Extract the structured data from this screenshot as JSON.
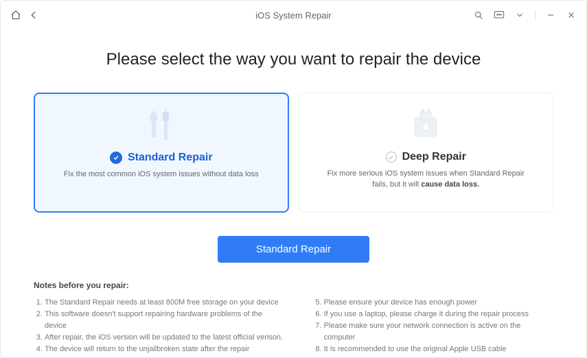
{
  "titlebar": {
    "title": "iOS System Repair"
  },
  "heading": "Please select the way you want to repair the device",
  "cards": {
    "standard": {
      "title": "Standard Repair",
      "desc": "Fix the most common iOS system issues without data loss"
    },
    "deep": {
      "title": "Deep Repair",
      "desc_pre": "Fix more serious iOS system issues when Standard Repair fails, but it will ",
      "desc_em": "cause data loss."
    }
  },
  "action": {
    "primary_label": "Standard Repair"
  },
  "notes": {
    "title": "Notes before you repair:",
    "left": [
      "The Standard Repair needs at least 800M free storage on your device",
      "This software doesn't support repairing hardware problems of the device",
      "After repair, the iOS version will be updated to the latest official verison.",
      "The device will return to the unjailbroken state after the repair"
    ],
    "right": [
      "Please ensure your device has enough power",
      "If you use a laptop, please charge it during the repair process",
      "Please make sure your network connection is active on the computer",
      "It is recommended to use the original Apple USB cable"
    ]
  }
}
